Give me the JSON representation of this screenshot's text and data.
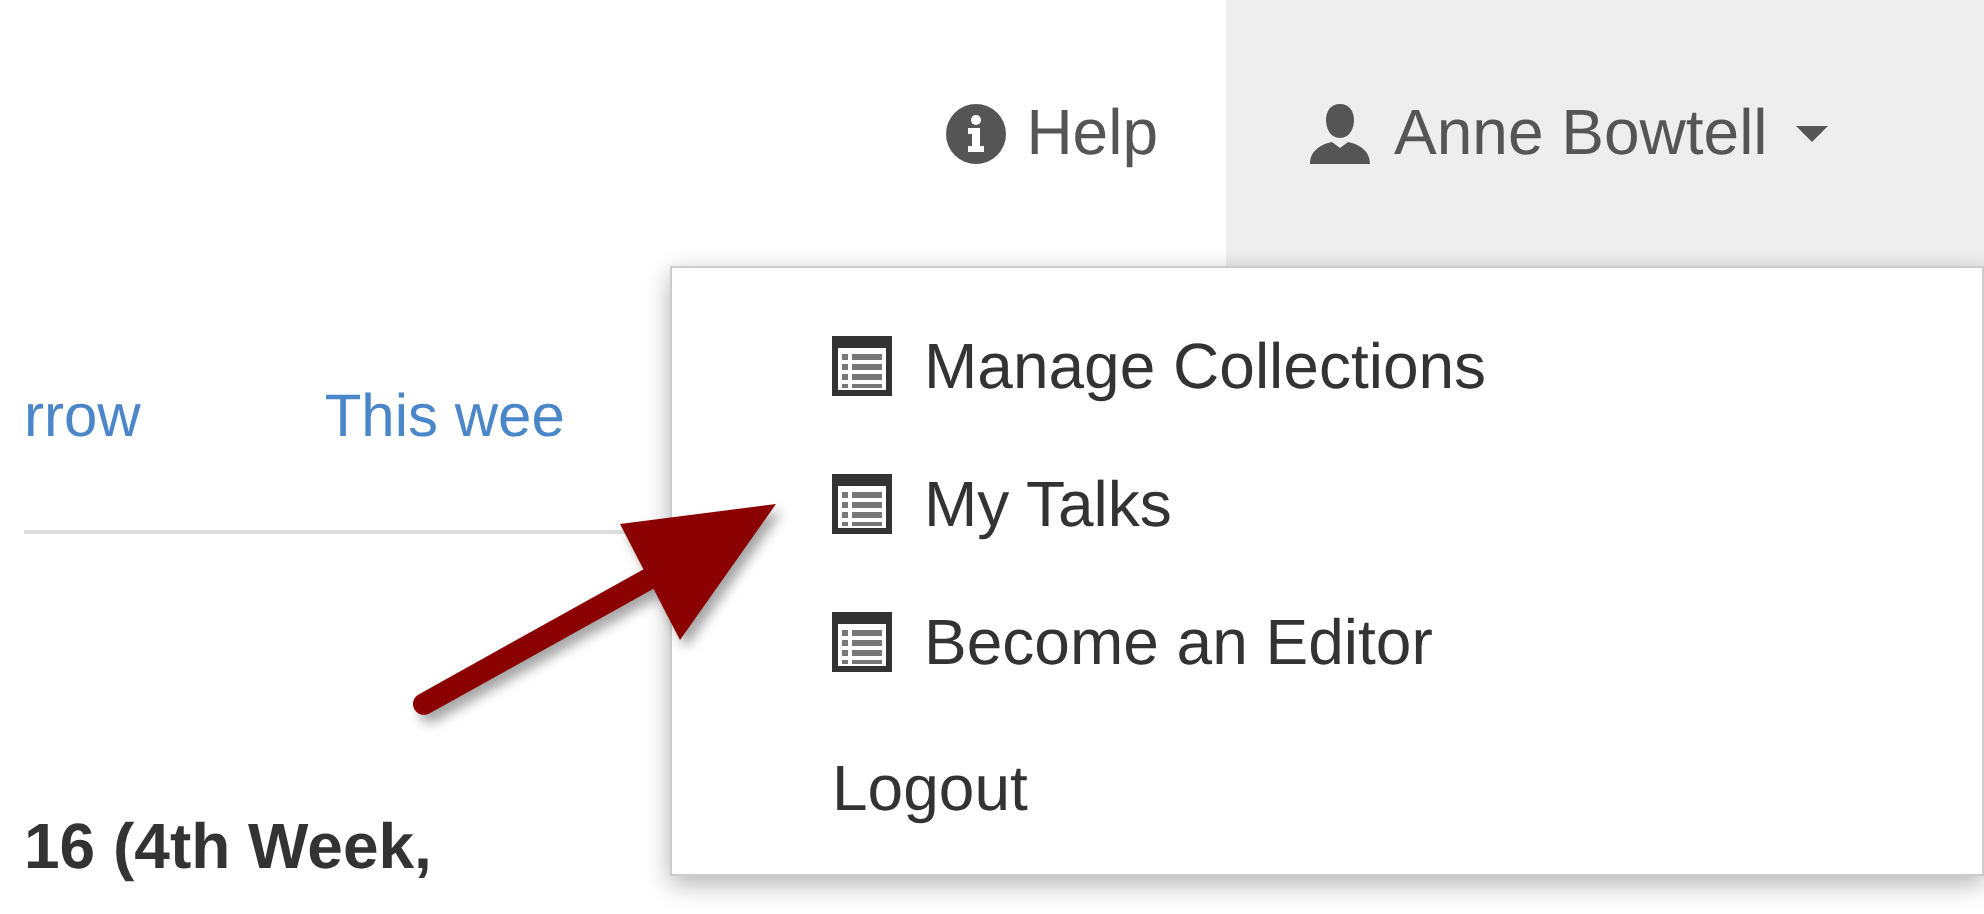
{
  "navbar": {
    "help": "Help",
    "user": {
      "name": "Anne Bowtell",
      "expanded": true
    }
  },
  "tabs": [
    {
      "label": "rrow"
    },
    {
      "label": "This wee"
    }
  ],
  "heading": "16 (4th Week,",
  "user_menu": [
    {
      "kind": "icon",
      "label": "Manage Collections"
    },
    {
      "kind": "icon",
      "label": "My Talks"
    },
    {
      "kind": "icon",
      "label": "Become an Editor"
    },
    {
      "kind": "plain",
      "label": "Logout"
    }
  ]
}
